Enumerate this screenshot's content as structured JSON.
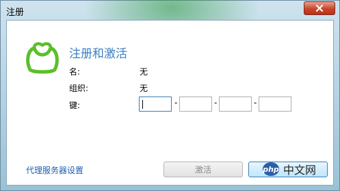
{
  "window": {
    "title": "注册"
  },
  "main": {
    "heading": "注册和激活",
    "fields": [
      {
        "label": "名:",
        "value": "无"
      },
      {
        "label": "组织:",
        "value": "无"
      },
      {
        "label": "键:"
      }
    ],
    "key_dash": "-"
  },
  "footer": {
    "proxy_link": "代理服务器设置",
    "activate_button": "激活"
  },
  "watermark": {
    "logo_text": "php",
    "text": "中文网"
  },
  "colors": {
    "accent": "#3b7fc4",
    "logo": "#5bbf2a",
    "close": "#c8452b"
  }
}
